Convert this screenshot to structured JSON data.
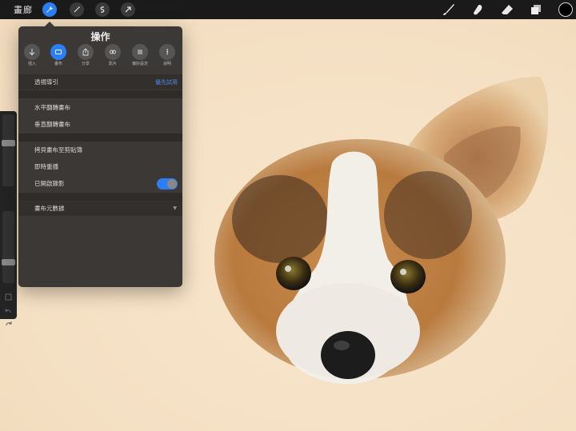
{
  "toolbar": {
    "gallery_label": "畫廊",
    "left_tools": [
      {
        "icon": "wrench-icon",
        "active": true
      },
      {
        "icon": "magic-wand-icon",
        "active": false
      },
      {
        "icon": "selection-icon",
        "active": false
      },
      {
        "icon": "transform-arrow-icon",
        "active": false
      }
    ],
    "right_tools": [
      "brush-icon",
      "smudge-icon",
      "eraser-icon",
      "layers-icon"
    ],
    "color": "#000000"
  },
  "panel": {
    "title": "操作",
    "tabs": [
      {
        "label": "插入",
        "icon": "insert-icon",
        "active": false
      },
      {
        "label": "畫布",
        "icon": "canvas-icon",
        "active": true
      },
      {
        "label": "分享",
        "icon": "share-icon",
        "active": false
      },
      {
        "label": "影片",
        "icon": "video-icon",
        "active": false
      },
      {
        "label": "偏好設定",
        "icon": "preferences-icon",
        "active": false
      },
      {
        "label": "說明",
        "icon": "info-icon",
        "active": false
      }
    ],
    "rows": {
      "perspective_guide": "透視導引",
      "perspective_value": "優先試用",
      "flip_horizontal": "水平翻轉畫布",
      "flip_vertical": "垂直翻轉畫布",
      "copy_canvas": "拷貝畫布至剪貼簿",
      "live_replay": "即時重播",
      "recording_enabled": "已開啟錄影",
      "canvas_metadata": "畫布元數據"
    },
    "recording_toggle_on": true
  },
  "colors": {
    "accent": "#2b7ef5",
    "canvas_bg": "#f6e3c8",
    "panel_bg": "#3c3835"
  }
}
